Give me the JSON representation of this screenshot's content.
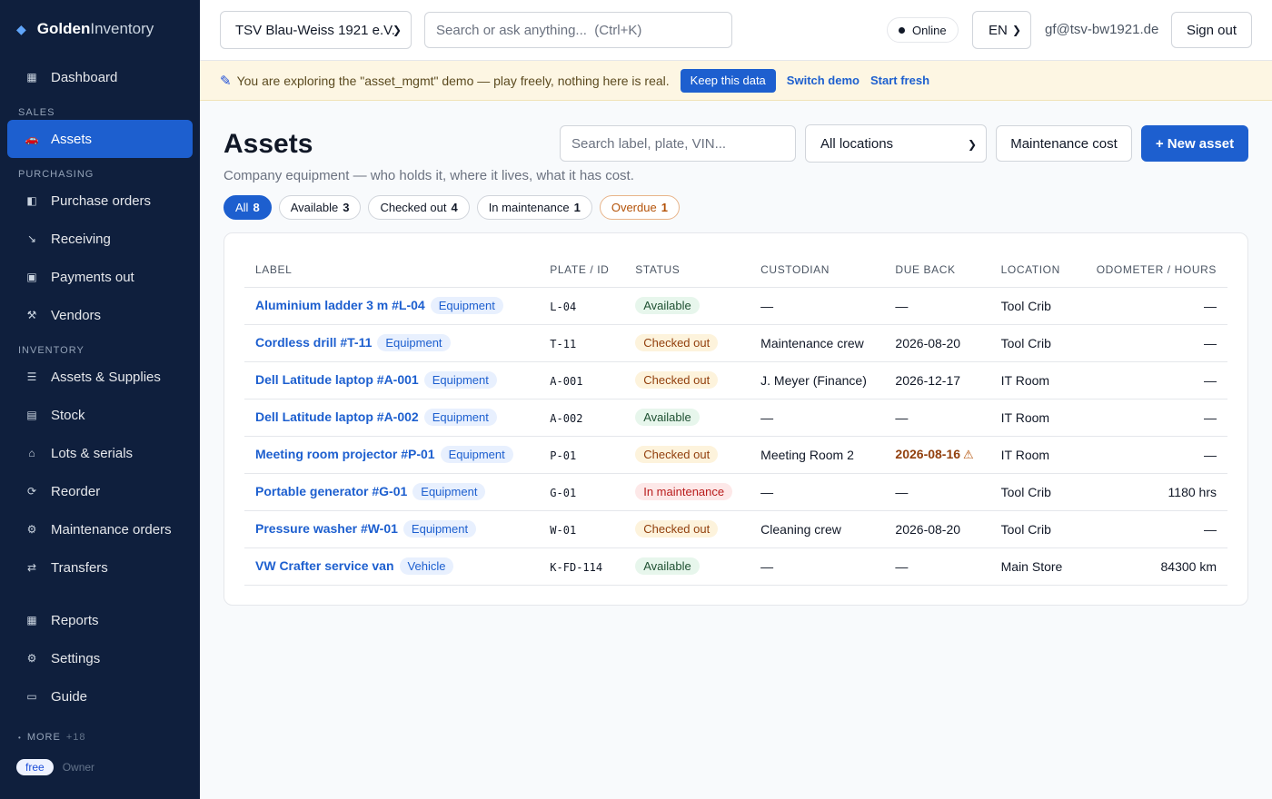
{
  "brand": {
    "name_a": "Golden",
    "name_b": "Inventory",
    "icon": "diamond-icon"
  },
  "sidebar": {
    "dashboard": "Dashboard",
    "sections": [
      {
        "title": "SALES",
        "items": [
          {
            "label": "Assets",
            "icon": "car-icon",
            "active": true
          }
        ]
      },
      {
        "title": "PURCHASING",
        "items": [
          {
            "label": "Purchase orders",
            "icon": "book-icon"
          },
          {
            "label": "Receiving",
            "icon": "arrow-icon"
          },
          {
            "label": "Payments out",
            "icon": "money-icon"
          },
          {
            "label": "Vendors",
            "icon": "tools-icon"
          }
        ]
      },
      {
        "title": "INVENTORY",
        "items": [
          {
            "label": "Assets & Supplies",
            "icon": "list-icon"
          },
          {
            "label": "Stock",
            "icon": "box-icon"
          },
          {
            "label": "Lots & serials",
            "icon": "tag-icon"
          },
          {
            "label": "Reorder",
            "icon": "refresh-icon"
          },
          {
            "label": "Maintenance orders",
            "icon": "gear-icon"
          },
          {
            "label": "Transfers",
            "icon": "swap-icon"
          }
        ]
      }
    ],
    "bottom": [
      {
        "label": "Reports",
        "icon": "grid-icon"
      },
      {
        "label": "Settings",
        "icon": "gear-icon"
      },
      {
        "label": "Guide",
        "icon": "book-open-icon"
      }
    ],
    "more_label": "MORE",
    "more_count": "+18",
    "plan": "free",
    "role": "Owner"
  },
  "topbar": {
    "org": "TSV Blau-Weiss 1921 e.V.",
    "search_placeholder": "Search or ask anything...  (Ctrl+K)",
    "status": "Online",
    "lang": "EN",
    "email": "gf@tsv-bw1921.de",
    "signout": "Sign out"
  },
  "banner": {
    "message": "You are exploring the \"asset_mgmt\" demo — play freely, nothing here is real.",
    "keep": "Keep this data",
    "switch": "Switch demo",
    "fresh": "Start fresh"
  },
  "page": {
    "title": "Assets",
    "subtitle": "Company equipment — who holds it, where it lives, what it has cost.",
    "search_placeholder": "Search label, plate, VIN...",
    "location_filter": "All locations",
    "maint_cost": "Maintenance cost",
    "new_asset": "+ New asset"
  },
  "filters": [
    {
      "label": "All",
      "count": "8",
      "active": true
    },
    {
      "label": "Available",
      "count": "3"
    },
    {
      "label": "Checked out",
      "count": "4"
    },
    {
      "label": "In maintenance",
      "count": "1"
    },
    {
      "label": "Overdue",
      "count": "1",
      "overdue": true
    }
  ],
  "table": {
    "columns": [
      "LABEL",
      "PLATE / ID",
      "STATUS",
      "CUSTODIAN",
      "DUE BACK",
      "LOCATION",
      "ODOMETER / HOURS"
    ],
    "rows": [
      {
        "label": "Aluminium ladder 3 m #L-04",
        "type": "Equipment",
        "plate": "L-04",
        "status": "Available",
        "custodian": "—",
        "due": "—",
        "location": "Tool Crib",
        "odometer": "—"
      },
      {
        "label": "Cordless drill #T-11",
        "type": "Equipment",
        "plate": "T-11",
        "status": "Checked out",
        "custodian": "Maintenance crew",
        "due": "2026-08-20",
        "location": "Tool Crib",
        "odometer": "—"
      },
      {
        "label": "Dell Latitude laptop #A-001",
        "type": "Equipment",
        "plate": "A-001",
        "status": "Checked out",
        "custodian": "J. Meyer (Finance)",
        "due": "2026-12-17",
        "location": "IT Room",
        "odometer": "—"
      },
      {
        "label": "Dell Latitude laptop #A-002",
        "type": "Equipment",
        "plate": "A-002",
        "status": "Available",
        "custodian": "—",
        "due": "—",
        "location": "IT Room",
        "odometer": "—"
      },
      {
        "label": "Meeting room projector #P-01",
        "type": "Equipment",
        "plate": "P-01",
        "status": "Checked out",
        "custodian": "Meeting Room 2",
        "due": "2026-08-16",
        "overdue": true,
        "location": "IT Room",
        "odometer": "—"
      },
      {
        "label": "Portable generator #G-01",
        "type": "Equipment",
        "plate": "G-01",
        "status": "In maintenance",
        "custodian": "—",
        "due": "—",
        "location": "Tool Crib",
        "odometer": "1180 hrs"
      },
      {
        "label": "Pressure washer #W-01",
        "type": "Equipment",
        "plate": "W-01",
        "status": "Checked out",
        "custodian": "Cleaning crew",
        "due": "2026-08-20",
        "location": "Tool Crib",
        "odometer": "—"
      },
      {
        "label": "VW Crafter service van",
        "type": "Vehicle",
        "plate": "K-FD-114",
        "status": "Available",
        "custodian": "—",
        "due": "—",
        "location": "Main Store",
        "odometer": "84300 km"
      }
    ]
  },
  "colors": {
    "sidebar_bg": "#0f1f3d",
    "accent": "#1d5fcf",
    "banner_bg": "#fdf6e3"
  }
}
